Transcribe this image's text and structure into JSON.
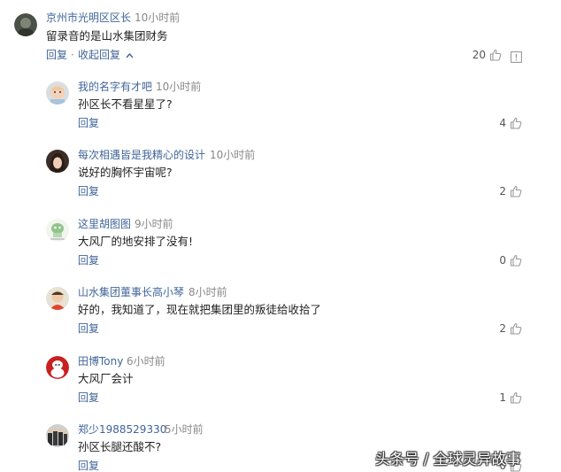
{
  "main_comment": {
    "username": "京州市光明区区长",
    "time": "10小时前",
    "text": "留录音的是山水集团财务",
    "reply_label": "回复",
    "separator": "·",
    "collapse_label": "收起回复",
    "collapse_icon": "chevron-up-icon",
    "likes": "20",
    "like_icon": "thumbs-up-icon",
    "report_icon": "report-icon"
  },
  "replies": [
    {
      "username": "我的名字有才吧",
      "time": "10小时前",
      "text": "孙区长不看星星了?",
      "reply_label": "回复",
      "likes": "4"
    },
    {
      "username": "每次相遇皆是我精心的设计",
      "time": "10小时前",
      "text": "说好的胸怀宇宙呢?",
      "reply_label": "回复",
      "likes": "2"
    },
    {
      "username": "这里胡图图",
      "time": "9小时前",
      "text": "大风厂的地安排了没有!",
      "reply_label": "回复",
      "likes": "0"
    },
    {
      "username": "山水集团董事长高小琴",
      "time": "8小时前",
      "text": "好的，我知道了，现在就把集团里的叛徒给收拾了",
      "reply_label": "回复",
      "likes": "2"
    },
    {
      "username": "田博Tony",
      "time": "6小时前",
      "text": "大风厂会计",
      "reply_label": "回复",
      "likes": "1"
    },
    {
      "username": "郑少1988529330",
      "time": "5小时前",
      "text": "孙区长腿还酸不?",
      "reply_label": "回复",
      "likes": "0"
    }
  ],
  "watermark": "头条号 / 全球灵异故事",
  "colors": {
    "link": "#406599",
    "time": "#888888",
    "text": "#222222",
    "icon": "#999999"
  }
}
